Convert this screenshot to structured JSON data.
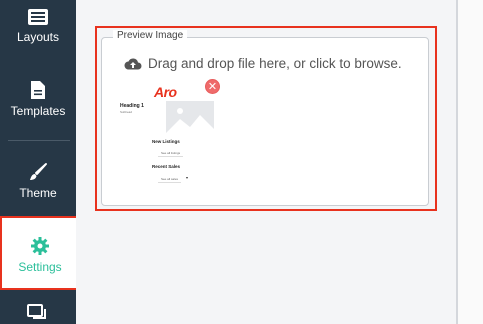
{
  "sidebar": {
    "items": [
      {
        "label": "Layouts",
        "icon": "layouts-icon"
      },
      {
        "label": "Templates",
        "icon": "document-icon"
      },
      {
        "label": "Theme",
        "icon": "brush-icon"
      },
      {
        "label": "Settings",
        "icon": "gear-icon",
        "active": true
      },
      {
        "label": "",
        "icon": "chat-icon"
      }
    ]
  },
  "preview": {
    "legend": "Preview Image",
    "drop_text": "Drag and drop file here, or click to browse.",
    "remove_symbol": "✕",
    "thumbnail": {
      "logo": "Aro",
      "heading": "Heading 1",
      "subheading": "Subhead",
      "section1": "New Listings",
      "button1": "See all listings",
      "section2": "Recent Sales",
      "button2": "See all sales",
      "select_symbol": "▾"
    }
  },
  "colors": {
    "sidebar_bg": "#263746",
    "accent": "#2bbf9a",
    "highlight": "#e8321e"
  }
}
